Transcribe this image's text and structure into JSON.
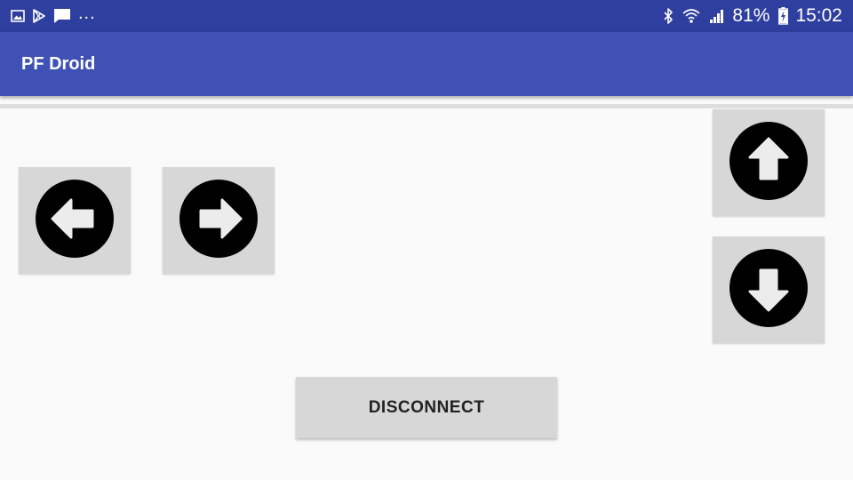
{
  "status_bar": {
    "dots": "...",
    "battery_percent": "81%",
    "time": "15:02",
    "background_color": "#2f3f9f",
    "left_icons": [
      "image-icon",
      "play-store-icon",
      "chat-icon"
    ],
    "right_icons": [
      "bluetooth-icon",
      "wifi-icon",
      "signal-icon",
      "battery-charging-icon"
    ]
  },
  "app_bar": {
    "title": "PF Droid",
    "background_color": "#3f51b5"
  },
  "controls": {
    "left_icon": "arrow-left-circle-icon",
    "right_icon": "arrow-right-circle-icon",
    "up_icon": "arrow-up-circle-icon",
    "down_icon": "arrow-down-circle-icon",
    "button_color": "#d6d7d6"
  },
  "disconnect_button": {
    "label": "DISCONNECT"
  }
}
